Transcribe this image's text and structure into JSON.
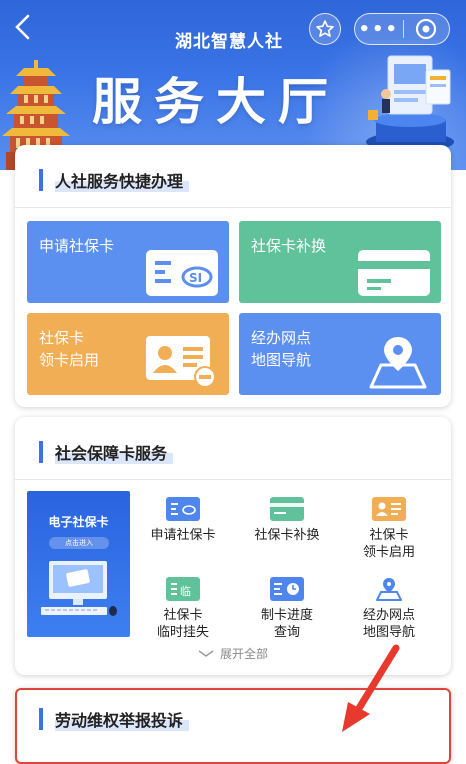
{
  "nav": {
    "title": "湖北智慧人社",
    "more_label": "•••"
  },
  "banner": {
    "title": "服务大厅"
  },
  "quick_section": {
    "title": "人社服务快捷办理",
    "tiles": [
      {
        "label": "申请社保卡",
        "color": "#5b8ff0"
      },
      {
        "label": "社保卡补换",
        "color": "#5fc29b"
      },
      {
        "label": "社保卡\n领卡启用",
        "color": "#f1ae55"
      },
      {
        "label": "经办网点\n地图导航",
        "color": "#5b8ff0"
      }
    ]
  },
  "card_section": {
    "title": "社会保障卡服务",
    "ecard_title": "电子社保卡",
    "ecard_button": "点击进入",
    "items": [
      {
        "label": "申请社保卡",
        "icon": "card-apply-icon",
        "color": "#4f86ee"
      },
      {
        "label": "社保卡补换",
        "icon": "card-replace-icon",
        "color": "#5fc29b"
      },
      {
        "label": "社保卡\n领卡启用",
        "icon": "card-activate-icon",
        "color": "#f1ae55"
      },
      {
        "label": "社保卡\n临时挂失",
        "icon": "card-loss-icon",
        "color": "#5fc29b"
      },
      {
        "label": "制卡进度\n查询",
        "icon": "progress-icon",
        "color": "#4f86ee"
      },
      {
        "label": "经办网点\n地图导航",
        "icon": "map-pin-icon",
        "color": "#4f86ee"
      }
    ],
    "expand_label": "展开全部"
  },
  "labor_section": {
    "title": "劳动维权举报投诉"
  },
  "colors": {
    "accent": "#3b73e6",
    "highlight_border": "#e0453a"
  }
}
